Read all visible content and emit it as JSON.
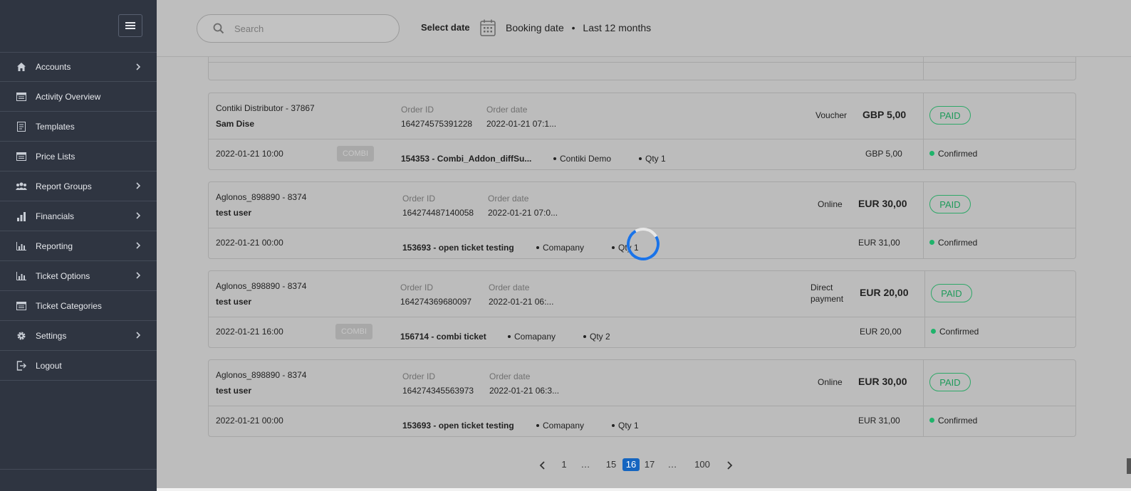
{
  "sidebar": {
    "items": [
      {
        "label": "Accounts",
        "icon": "home-icon",
        "has_children": true
      },
      {
        "label": "Activity Overview",
        "icon": "list-card-icon",
        "has_children": false
      },
      {
        "label": "Templates",
        "icon": "document-icon",
        "has_children": false
      },
      {
        "label": "Price Lists",
        "icon": "list-card-icon",
        "has_children": false
      },
      {
        "label": "Report Groups",
        "icon": "users-icon",
        "has_children": true
      },
      {
        "label": "Financials",
        "icon": "bar-chart-icon",
        "has_children": true
      },
      {
        "label": "Reporting",
        "icon": "chart-icon",
        "has_children": true
      },
      {
        "label": "Ticket Options",
        "icon": "chart-icon",
        "has_children": true
      },
      {
        "label": "Ticket Categories",
        "icon": "list-card-icon",
        "has_children": false
      },
      {
        "label": "Settings",
        "icon": "gear-icon",
        "has_children": true
      },
      {
        "label": "Logout",
        "icon": "logout-icon",
        "has_children": false
      }
    ]
  },
  "header": {
    "search_placeholder": "Search",
    "select_date_label": "Select date",
    "date_type": "Booking date",
    "separator": "•",
    "date_range": "Last 12 months"
  },
  "orders": [
    {
      "distributor": "Contiki Distributor - 37867",
      "customer": "Sam Dise",
      "order_id_label": "Order ID",
      "order_id": "164274575391228",
      "order_date_label": "Order date",
      "order_date": "2022-01-21 07:1...",
      "payment_method": "Voucher",
      "total": "GBP 5,00",
      "status": "PAID",
      "visit_date": "2022-01-21 10:00",
      "tag": "COMBI",
      "product": "154353 - Combi_Addon_diffSu...",
      "supplier": "Contiki Demo",
      "qty": "Qty 1",
      "line_price": "GBP 5,00",
      "line_status": "Confirmed"
    },
    {
      "distributor": "Aglonos_898890 - 8374",
      "customer": "test user",
      "order_id_label": "Order ID",
      "order_id": "164274487140058",
      "order_date_label": "Order date",
      "order_date": "2022-01-21 07:0...",
      "payment_method": "Online",
      "total": "EUR 30,00",
      "status": "PAID",
      "visit_date": "2022-01-21 00:00",
      "tag": "",
      "product": "153693 - open ticket testing",
      "supplier": "Comapany",
      "qty": "Qty 1",
      "line_price": "EUR 31,00",
      "line_status": "Confirmed"
    },
    {
      "distributor": "Aglonos_898890 - 8374",
      "customer": "test user",
      "order_id_label": "Order ID",
      "order_id": "164274369680097",
      "order_date_label": "Order date",
      "order_date": "2022-01-21 06:...",
      "payment_method_line1": "Direct",
      "payment_method_line2": "payment",
      "total": "EUR 20,00",
      "status": "PAID",
      "visit_date": "2022-01-21 16:00",
      "tag": "COMBI",
      "product": "156714 - combi ticket",
      "supplier": "Comapany",
      "qty": "Qty 2",
      "line_price": "EUR 20,00",
      "line_status": "Confirmed"
    },
    {
      "distributor": "Aglonos_898890 - 8374",
      "customer": "test user",
      "order_id_label": "Order ID",
      "order_id": "164274345563973",
      "order_date_label": "Order date",
      "order_date": "2022-01-21 06:3...",
      "payment_method": "Online",
      "total": "EUR 30,00",
      "status": "PAID",
      "visit_date": "2022-01-21 00:00",
      "tag": "",
      "product": "153693 - open ticket testing",
      "supplier": "Comapany",
      "qty": "Qty 1",
      "line_price": "EUR 31,00",
      "line_status": "Confirmed"
    }
  ],
  "pagination": {
    "pages": [
      "1",
      "…",
      "15",
      "16",
      "17",
      "…",
      "100"
    ],
    "current": "16"
  },
  "colors": {
    "sidebar_bg": "#2f3541",
    "accent": "#1565c0",
    "paid": "#1e9a5a",
    "confirmed_dot": "#1fb36b"
  }
}
